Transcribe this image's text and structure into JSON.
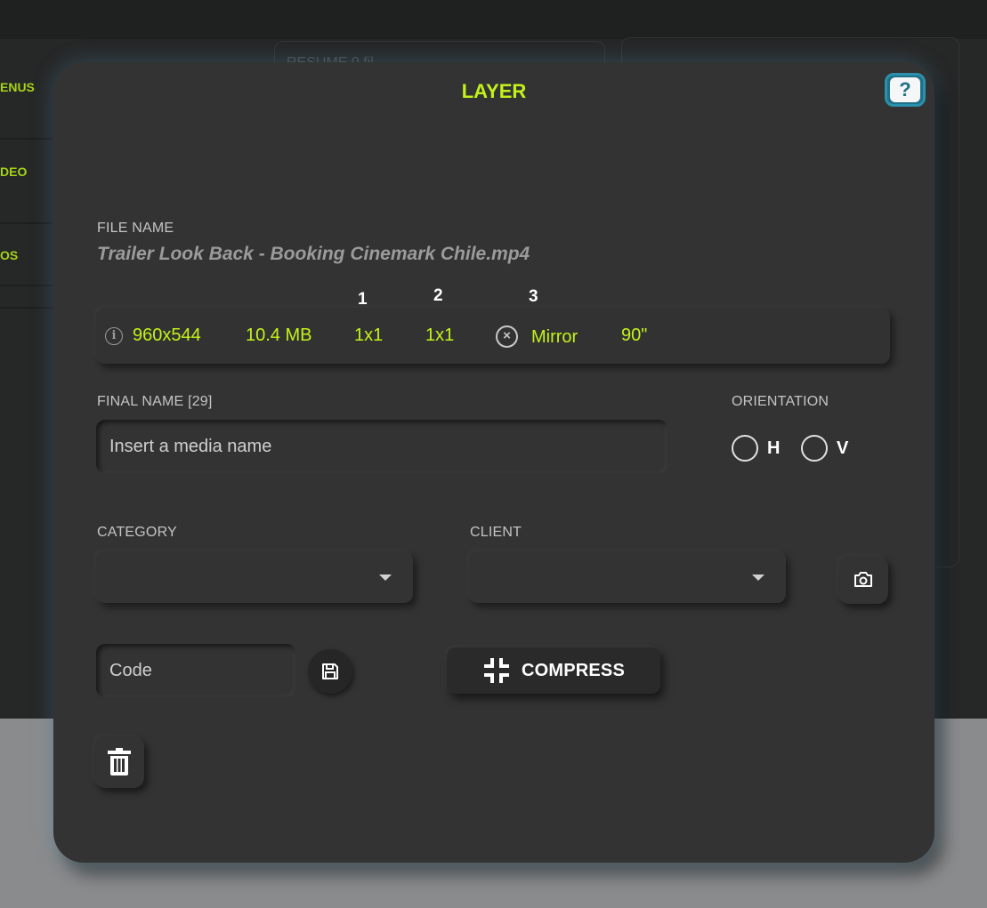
{
  "background": {
    "sidebar_items": [
      "ENUS",
      "DEO",
      "OS"
    ],
    "card_text": "RESUME 0 fil"
  },
  "modal": {
    "title": "LAYER",
    "help_label": "?",
    "file_name_label": "FILE NAME",
    "file_name": "Trailer Look Back - Booking Cinemark Chile.mp4",
    "markers": [
      "1",
      "2",
      "3"
    ],
    "info": {
      "info_icon_glyph": "i",
      "resolution": "960x544",
      "size": "10.4 MB",
      "ratio_1": "1x1",
      "ratio_2": "1x1",
      "mirror_icon_glyph": "×",
      "mirror": "Mirror",
      "rotation": "90\""
    },
    "final_name_label": "FINAL NAME [29]",
    "final_name_placeholder": "Insert a media name",
    "orientation_label": "ORIENTATION",
    "orientation_h": "H",
    "orientation_v": "V",
    "category_label": "CATEGORY",
    "client_label": "CLIENT",
    "code_placeholder": "Code",
    "compress_label": "COMPRESS"
  },
  "colors": {
    "accent": "#c3f21a",
    "modal_bg": "#333333",
    "help_blue": "#1f6f86"
  }
}
